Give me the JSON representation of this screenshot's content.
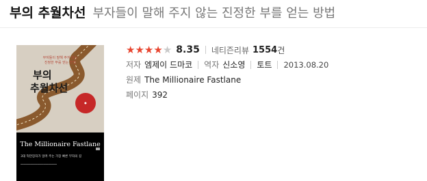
{
  "header": {
    "title": "부의 추월차선",
    "subtitle": "부자들이 말해 주지 않는 진정한 부를 얻는 방법"
  },
  "book": {
    "cover": {
      "tagline_1": "부자들이 말해 주지 않는",
      "tagline_2": "진정한 부를 얻는 방법",
      "title_line1": "부의",
      "title_line2": "추월차선",
      "english_title": "The Millionaire Fastlane",
      "quote": "3대 억만장자가 알려 주는 가장 빠른 부자의 길"
    },
    "rating": {
      "stars_filled": 4,
      "stars_total": 5,
      "score": "8.35",
      "reviews_label": "네티즌리뷰",
      "reviews_count": "1554",
      "reviews_unit": "건"
    },
    "author_label": "저자",
    "author": "엠제이 드마코",
    "translator_label": "역자",
    "translator": "신소영",
    "publisher": "토트",
    "date": "2013.08.20",
    "original_label": "원제",
    "original_title": "The Millionaire Fastlane",
    "pages_label": "페이지",
    "pages": "392"
  },
  "colors": {
    "star_on": "#e8452f",
    "star_off": "#c9c9c9",
    "cover_bg": "#000000"
  }
}
